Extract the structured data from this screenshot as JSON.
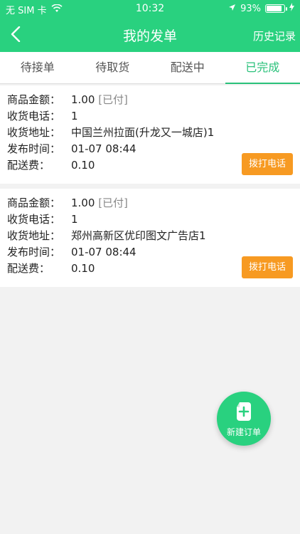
{
  "status_bar": {
    "carrier": "无 SIM 卡",
    "time": "10:32",
    "battery": "93%",
    "battery_level": 0.93
  },
  "nav": {
    "title": "我的发单",
    "history": "历史记录"
  },
  "tabs": [
    {
      "label": "待接单"
    },
    {
      "label": "待取货"
    },
    {
      "label": "配送中"
    },
    {
      "label": "已完成"
    }
  ],
  "active_tab": 3,
  "orders": [
    {
      "amount_label": "商品金额：",
      "amount": "1.00",
      "paid": "[已付]",
      "phone_label": "收货电话：",
      "phone": "1",
      "address_label": "收货地址：",
      "address": "中国兰州拉面(升龙又一城店)1",
      "time_label": "发布时间：",
      "time": "01-07 08:44",
      "fee_label": "配送费：",
      "fee": "0.10",
      "call_label": "拨打电话"
    },
    {
      "amount_label": "商品金额：",
      "amount": "1.00",
      "paid": "[已付]",
      "phone_label": "收货电话：",
      "phone": "1",
      "address_label": "收货地址：",
      "address": "郑州高新区优印图文广告店1",
      "time_label": "发布时间：",
      "time": "01-07 08:44",
      "fee_label": "配送费：",
      "fee": "0.10",
      "call_label": "拨打电话"
    }
  ],
  "fab": {
    "label": "新建订单"
  },
  "colors": {
    "primary": "#29d17f",
    "accent": "#f79a22"
  }
}
